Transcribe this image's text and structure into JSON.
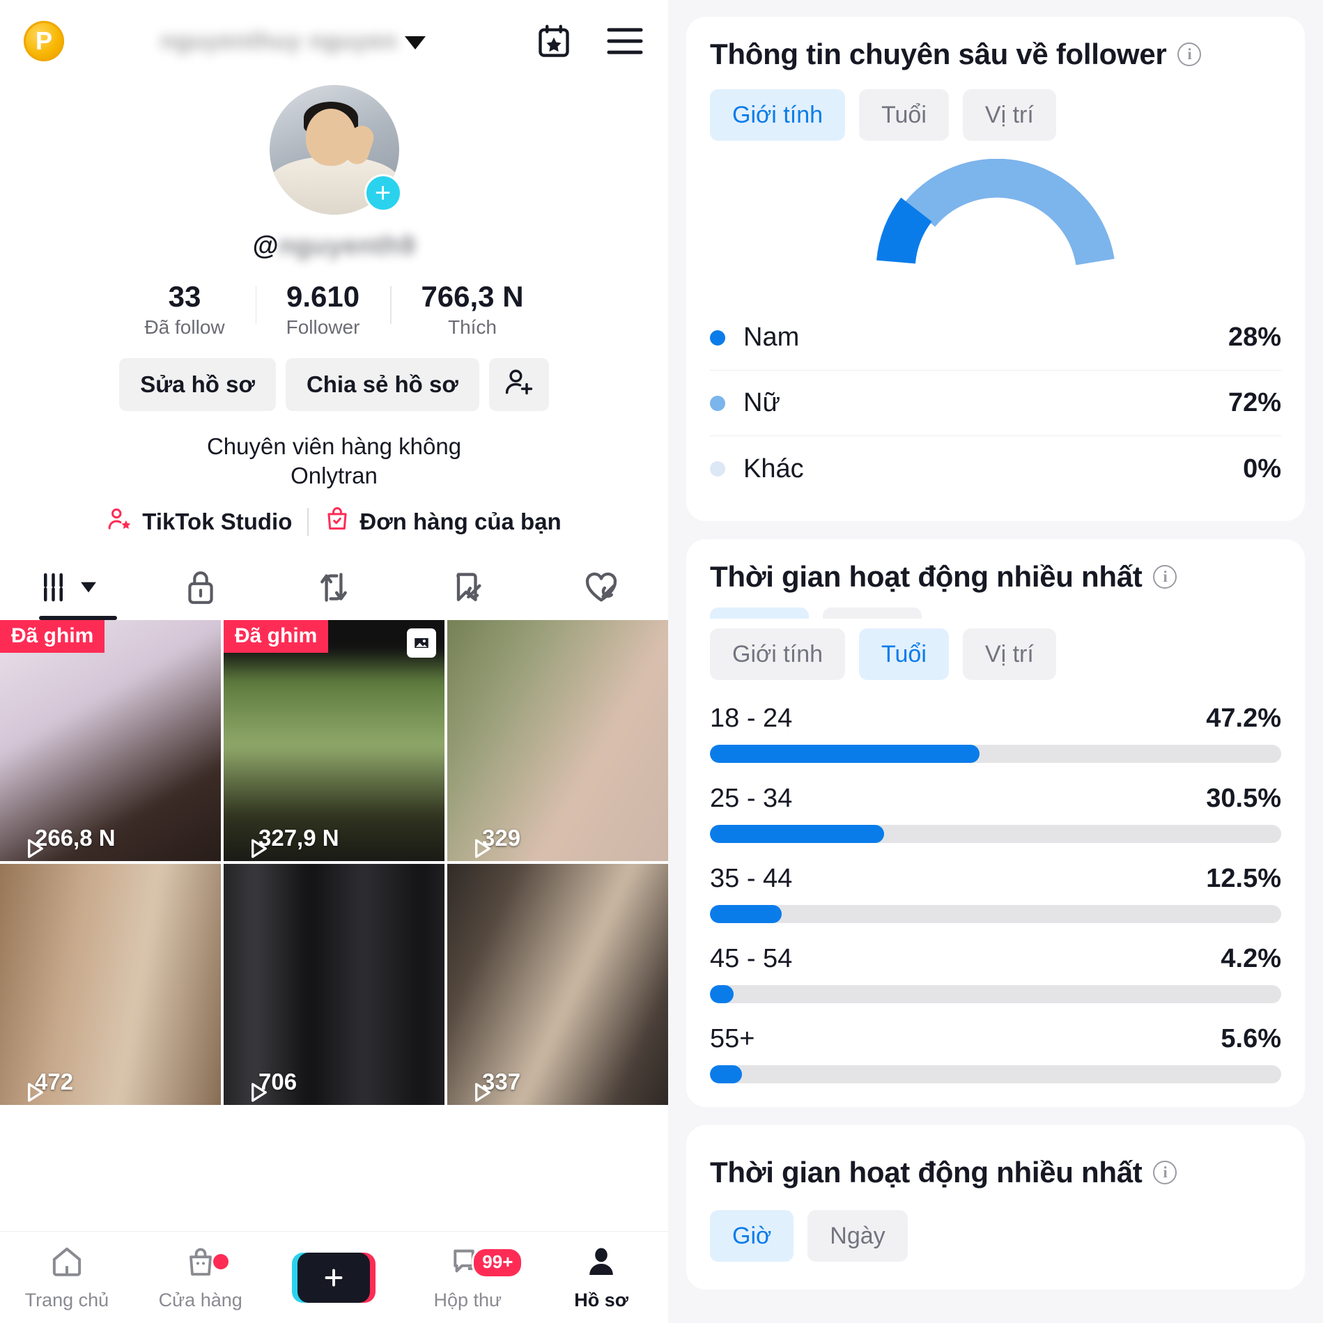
{
  "left": {
    "topbar": {
      "coin_label": "P",
      "username_blurred": "nguyenthuy nguyen",
      "chevron_icon": "chevron-down-icon",
      "calendar_icon": "calendar-star-icon",
      "menu_icon": "hamburger-menu-icon"
    },
    "profile": {
      "handle_at": "@",
      "handle_blurred": "nguyenth9",
      "add_icon": "plus-icon",
      "stats": [
        {
          "value": "33",
          "label": "Đã follow"
        },
        {
          "value": "9.610",
          "label": "Follower"
        },
        {
          "value": "766,3 N",
          "label": "Thích"
        }
      ],
      "actions": {
        "edit_profile": "Sửa hồ sơ",
        "share_profile": "Chia sẻ hồ sơ",
        "add_friend_icon": "add-person-icon"
      },
      "bio_line1": "Chuyên viên hàng không",
      "bio_line2": "Onlytran",
      "links": [
        {
          "label": "TikTok Studio",
          "icon": "person-star-icon"
        },
        {
          "label": "Đơn hàng của bạn",
          "icon": "shopping-bag-check-icon"
        }
      ]
    },
    "tabs": [
      {
        "name": "tab-videos",
        "icon": "grid-videos-icon",
        "active": true,
        "has_caret": true
      },
      {
        "name": "tab-private",
        "icon": "lock-icon",
        "active": false
      },
      {
        "name": "tab-reposts",
        "icon": "repost-icon",
        "active": false
      },
      {
        "name": "tab-saved",
        "icon": "bookmark-hidden-icon",
        "active": false
      },
      {
        "name": "tab-liked",
        "icon": "heart-hidden-icon",
        "active": false
      }
    ],
    "grid": [
      {
        "pinned_label": "Đã ghim",
        "views": "266,8 N",
        "multi": false,
        "tone": "#e6dbe8"
      },
      {
        "pinned_label": "Đã ghim",
        "views": "327,9 N",
        "multi": true,
        "tone": "#2d3a24"
      },
      {
        "pinned_label": "",
        "views": "329",
        "multi": false,
        "tone": "#7d7565"
      },
      {
        "pinned_label": "",
        "views": "472",
        "multi": false,
        "tone": "#b6a089"
      },
      {
        "pinned_label": "",
        "views": "706",
        "multi": false,
        "tone": "#181818"
      },
      {
        "pinned_label": "",
        "views": "337",
        "multi": false,
        "tone": "#4a443f"
      }
    ],
    "bottom_nav": [
      {
        "label": "Trang chủ",
        "icon": "home-icon",
        "active": false,
        "badge": ""
      },
      {
        "label": "Cửa hàng",
        "icon": "shop-bag-icon",
        "active": false,
        "badge": "dot"
      },
      {
        "label": "",
        "icon": "create-plus-icon",
        "active": false,
        "badge": ""
      },
      {
        "label": "Hộp thư",
        "icon": "inbox-icon",
        "active": false,
        "badge": "99+"
      },
      {
        "label": "Hồ sơ",
        "icon": "person-icon",
        "active": true,
        "badge": ""
      }
    ]
  },
  "right": {
    "follower_insights": {
      "title": "Thông tin chuyên sâu về follower",
      "info_icon": "info-icon",
      "chips": [
        {
          "label": "Giới tính",
          "active": true
        },
        {
          "label": "Tuổi",
          "active": false
        },
        {
          "label": "Vị trí",
          "active": false
        }
      ],
      "legend": [
        {
          "name": "Nam",
          "value": "28%",
          "color": "#0a7cea"
        },
        {
          "name": "Nữ",
          "value": "72%",
          "color": "#7cb4ec"
        },
        {
          "name": "Khác",
          "value": "0%",
          "color": "#dde8f5"
        }
      ]
    },
    "most_active_age": {
      "title": "Thời gian hoạt động nhiều nhất",
      "info_icon": "info-icon",
      "chips": [
        {
          "label": "Giới tính",
          "active": false
        },
        {
          "label": "Tuổi",
          "active": true
        },
        {
          "label": "Vị trí",
          "active": false
        }
      ]
    },
    "most_active_time": {
      "title": "Thời gian hoạt động nhiều nhất",
      "info_icon": "info-icon",
      "chips": [
        {
          "label": "Giờ",
          "active": true
        },
        {
          "label": "Ngày",
          "active": false
        }
      ]
    }
  },
  "chart_data": [
    {
      "type": "pie",
      "title": "Thông tin chuyên sâu về follower",
      "subtitle": "Giới tính",
      "shape": "half-donut-gauge",
      "labels": [
        "Nam",
        "Nữ",
        "Khác"
      ],
      "values": [
        28,
        72,
        0
      ],
      "value_labels": [
        "28%",
        "72%",
        "0%"
      ],
      "colors": [
        "#0a7cea",
        "#7cb4ec",
        "#dde8f5"
      ],
      "legend": "below"
    },
    {
      "type": "bar",
      "orientation": "horizontal",
      "title": "Thời gian hoạt động nhiều nhất",
      "subtitle": "Tuổi",
      "categories": [
        "18 - 24",
        "25 - 34",
        "35 - 44",
        "45 - 54",
        "55+"
      ],
      "values": [
        47.2,
        30.5,
        12.5,
        4.2,
        5.6
      ],
      "value_labels": [
        "47.2%",
        "30.5%",
        "12.5%",
        "4.2%",
        "5.6%"
      ],
      "xlabel": "",
      "ylabel": "",
      "xlim": [
        0,
        100
      ],
      "grid": false,
      "bar_color": "#0a7cea",
      "track_color": "#e4e4e6"
    }
  ]
}
